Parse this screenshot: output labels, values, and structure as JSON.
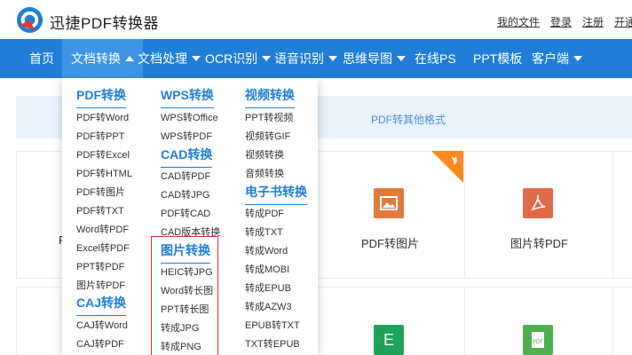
{
  "header": {
    "app_title": "迅捷PDF转换器",
    "links": [
      "我的文件",
      "登录",
      "注册",
      "开通"
    ]
  },
  "nav": {
    "items": [
      "首页",
      "文档转换",
      "文档处理",
      "OCR识别",
      "语音识别",
      "思维导图",
      "在线PS",
      "PPT模板",
      "客户端"
    ]
  },
  "banner": {
    "text": "PDF转其他格式"
  },
  "tools": [
    {
      "label": "PDF转图片",
      "color": "#e07b3e"
    },
    {
      "label": "图片转PDF",
      "color": "#e06b4a"
    },
    {
      "label": "E",
      "color": "#1fa35b"
    },
    {
      "label": "PDF",
      "color": "#4caf50"
    }
  ],
  "behind_char": "P",
  "dropdown": {
    "col1": {
      "head1": "PDF转换",
      "items1": [
        "PDF转Word",
        "PDF转PPT",
        "PDF转Excel",
        "PDF转HTML",
        "PDF转图片",
        "PDF转TXT",
        "Word转PDF",
        "Excel转PDF",
        "PPT转PDF",
        "图片转PDF"
      ],
      "head2": "CAJ转换",
      "items2": [
        "CAJ转Word",
        "CAJ转PDF"
      ]
    },
    "col2": {
      "head1": "WPS转换",
      "items1": [
        "WPS转Office",
        "WPS转PDF"
      ],
      "head2": "CAD转换",
      "items2": [
        "CAD转PDF",
        "CAD转JPG",
        "PDF转CAD",
        "CAD版本转换"
      ],
      "head3": "图片转换",
      "items3": [
        "HEIC转JPG",
        "Word转长图",
        "PPT转长图",
        "转成JPG",
        "转成PNG"
      ]
    },
    "col3": {
      "head1": "视频转换",
      "items1": [
        "PPT转视频",
        "视频转GIF",
        "视频转换",
        "音频转换"
      ],
      "head2": "电子书转换",
      "items2": [
        "转成PDF",
        "转成TXT",
        "转成Word",
        "转成MOBI",
        "转成EPUB",
        "转成AZW3",
        "EPUB转TXT",
        "TXT转EPUB"
      ]
    }
  }
}
